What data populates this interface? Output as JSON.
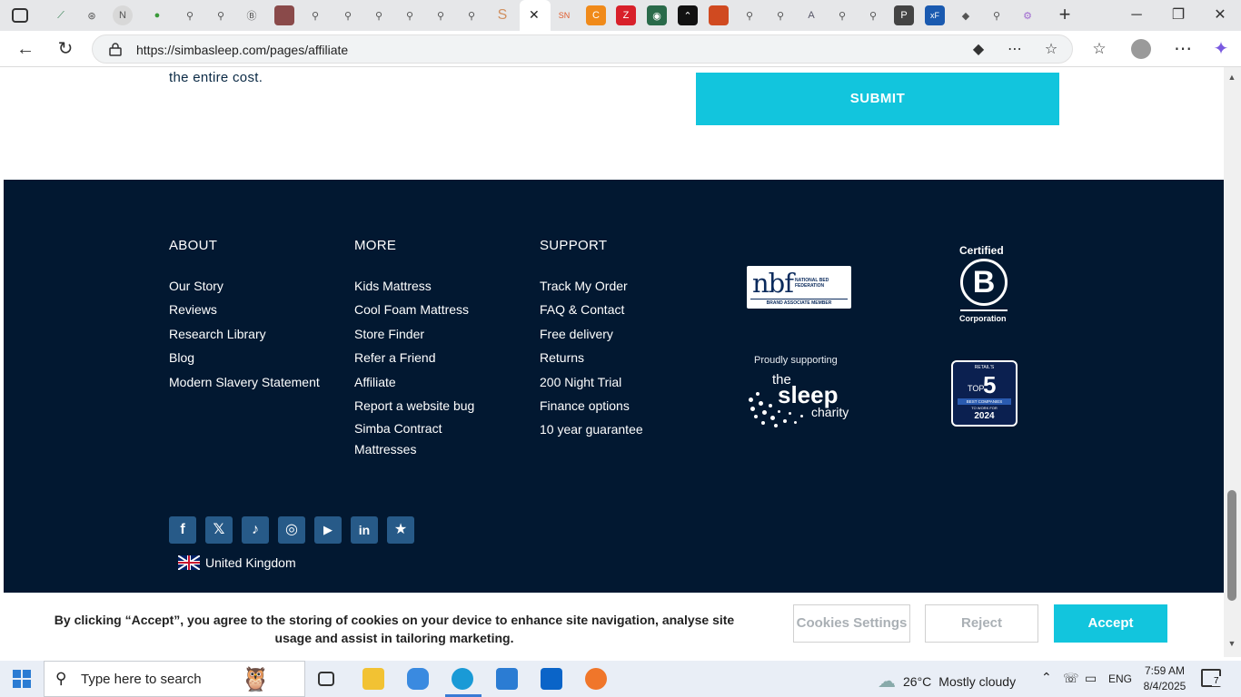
{
  "browser": {
    "url": "https://simbasleep.com/pages/affiliate",
    "tab_close_glyph": "✕",
    "new_tab_glyph": "+",
    "window_controls": [
      "─",
      "❐",
      "✕"
    ]
  },
  "page": {
    "top_text": "the entire cost.",
    "submit_label": "SUBMIT"
  },
  "footer": {
    "about": {
      "heading": "ABOUT",
      "links": [
        "Our Story",
        "Reviews",
        "Research Library",
        "Blog",
        "Modern Slavery Statement"
      ]
    },
    "more": {
      "heading": "MORE",
      "links": [
        "Kids Mattress",
        "Cool Foam Mattress",
        "Store Finder",
        "Refer a Friend",
        "Affiliate",
        "Report a website bug",
        "Simba Contract Mattresses"
      ]
    },
    "support": {
      "heading": "SUPPORT",
      "links": [
        "Track My Order",
        "FAQ & Contact",
        "Free delivery",
        "Returns",
        "200 Night Trial",
        "Finance options",
        "10 year guarantee"
      ]
    },
    "nbf": {
      "big": "nbf",
      "small_line1": "NATIONAL BED",
      "small_line2": "FEDERATION",
      "band": "BRAND ASSOCIATE MEMBER"
    },
    "bcorp": {
      "certified": "Certified",
      "letter": "B",
      "corporation": "Corporation"
    },
    "charity": {
      "proudly": "Proudly supporting",
      "the": "the",
      "sleep": "sleep",
      "charity": "charity"
    },
    "top5": {
      "retail": "RETAIL'S",
      "top": "TOP",
      "five": "5",
      "best": "BEST COMPANIES",
      "work": "TO WORK FOR",
      "year": "2024"
    },
    "social": [
      {
        "name": "facebook",
        "glyph": "f"
      },
      {
        "name": "x",
        "glyph": "𝕏"
      },
      {
        "name": "tiktok",
        "glyph": "♪"
      },
      {
        "name": "instagram",
        "glyph": "◎"
      },
      {
        "name": "youtube",
        "glyph": "▶"
      },
      {
        "name": "linkedin",
        "glyph": "in"
      },
      {
        "name": "trustpilot",
        "glyph": "★"
      }
    ],
    "country": "United Kingdom"
  },
  "cookie": {
    "text": "By clicking “Accept”, you agree to the storing of cookies on your device to enhance site navigation, analyse site usage and assist in tailoring marketing.",
    "settings_label": "Cookies Settings",
    "reject_label": "Reject",
    "accept_label": "Accept"
  },
  "taskbar": {
    "search_placeholder": "Type here to search",
    "temperature": "26°C",
    "weather": "Mostly cloudy",
    "language": "ENG",
    "time": "7:59 AM",
    "date": "8/4/2025",
    "notification_count": "7"
  },
  "colors": {
    "footer_bg": "#021831",
    "accent": "#12c5dd",
    "social_bg": "#275a88"
  }
}
